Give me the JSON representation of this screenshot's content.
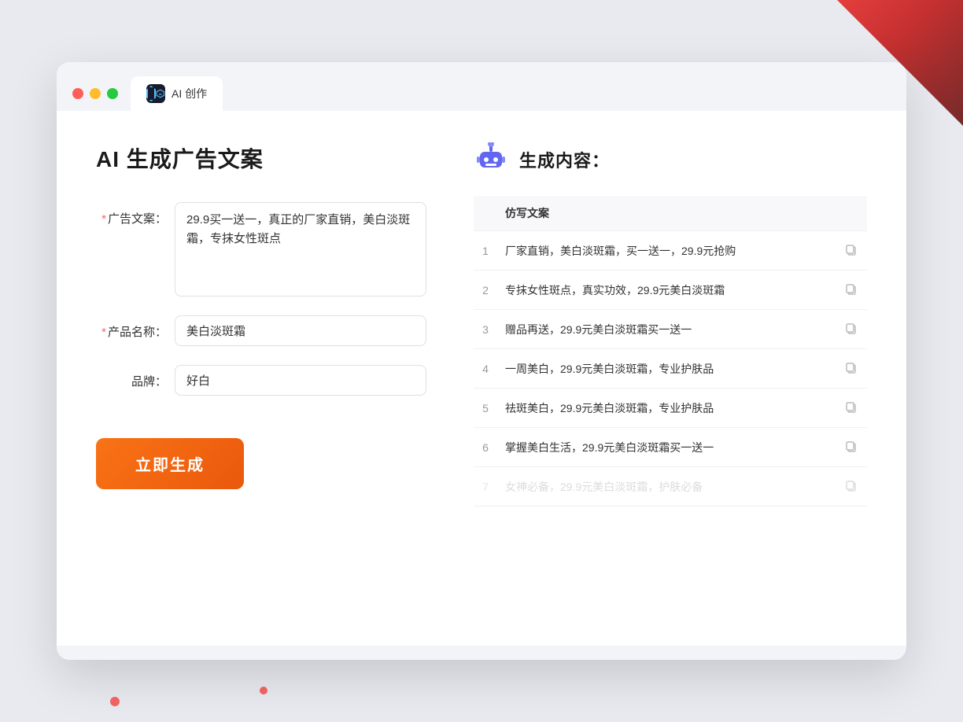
{
  "window": {
    "tab_label": "AI 创作",
    "traffic_lights": [
      "red",
      "yellow",
      "green"
    ]
  },
  "left": {
    "page_title": "AI 生成广告文案",
    "form": {
      "ad_copy_label": "广告文案：",
      "ad_copy_required": true,
      "ad_copy_value": "29.9买一送一，真正的厂家直销，美白淡斑霜，专抹女性斑点",
      "product_name_label": "产品名称：",
      "product_name_required": true,
      "product_name_value": "美白淡斑霜",
      "brand_label": "品牌：",
      "brand_required": false,
      "brand_value": "好白"
    },
    "generate_button": "立即生成"
  },
  "right": {
    "result_title": "生成内容：",
    "table_header": "仿写文案",
    "results": [
      {
        "num": 1,
        "text": "厂家直销，美白淡斑霜，买一送一，29.9元抢购"
      },
      {
        "num": 2,
        "text": "专抹女性斑点，真实功效，29.9元美白淡斑霜"
      },
      {
        "num": 3,
        "text": "赠品再送，29.9元美白淡斑霜买一送一"
      },
      {
        "num": 4,
        "text": "一周美白，29.9元美白淡斑霜，专业护肤品"
      },
      {
        "num": 5,
        "text": "祛斑美白，29.9元美白淡斑霜，专业护肤品"
      },
      {
        "num": 6,
        "text": "掌握美白生活，29.9元美白淡斑霜买一送一"
      },
      {
        "num": 7,
        "text": "女神必备，29.9元美白淡斑霜，护肤必备"
      }
    ]
  }
}
